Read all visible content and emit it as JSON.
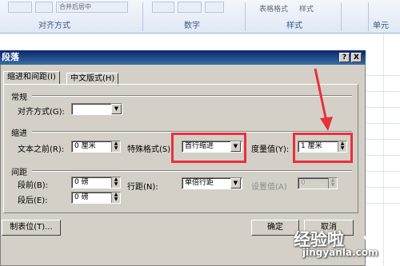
{
  "ribbon": {
    "merge_center_label": "合并后居中",
    "groups": [
      {
        "label": "对齐方式"
      },
      {
        "label": "数字"
      },
      {
        "label": "样式"
      },
      {
        "label": "单元"
      }
    ],
    "table_format_label": "表格格式",
    "cell_style_label": "样式"
  },
  "dialog": {
    "title": "段落",
    "help_btn": "?",
    "close_btn": "X",
    "tabs": [
      {
        "label": "缩进和间距(I)"
      },
      {
        "label": "中文版式(H)"
      }
    ],
    "general": {
      "heading": "常规",
      "alignment_label": "对齐方式(G):",
      "alignment_value": ""
    },
    "indent": {
      "heading": "缩进",
      "before_label": "文本之前(R):",
      "before_value": "0 厘米",
      "special_label": "特殊格式(S):",
      "special_value": "首行缩进",
      "measure_label": "度量值(Y):",
      "measure_value": "1 厘米"
    },
    "spacing": {
      "heading": "间距",
      "before_label": "段前(B):",
      "before_value": "0 磅",
      "after_label": "段后(E):",
      "after_value": "0 磅",
      "line_label": "行距(N):",
      "line_value": "单倍行距",
      "setvalue_label": "设置值(A)",
      "setvalue_value": "0"
    },
    "tabs_button": "制表位(T)...",
    "ok_button": "确定",
    "cancel_button": "取消"
  },
  "watermark": {
    "main": "经验啦",
    "sub": "jingyanla.com"
  },
  "colors": {
    "highlight": "#e8313a",
    "title_bar": "#0a246a",
    "dialog_bg": "#d4d0c8"
  }
}
